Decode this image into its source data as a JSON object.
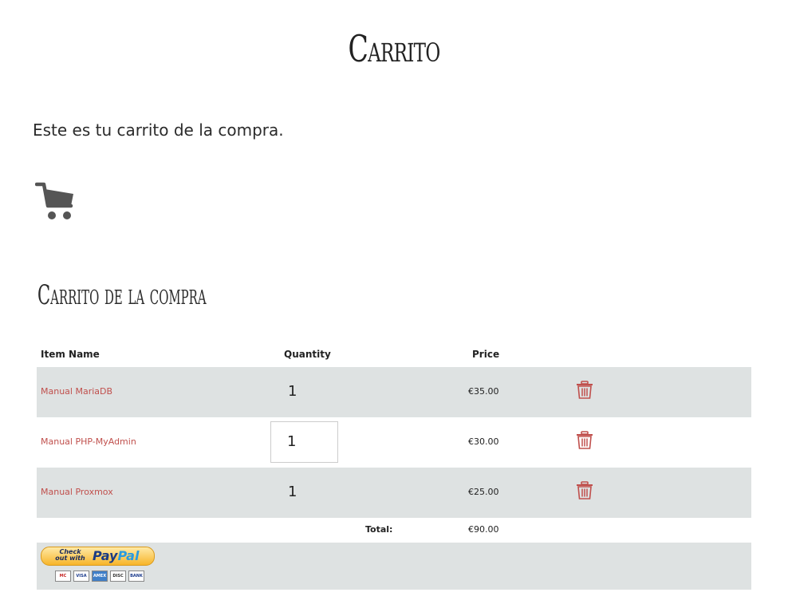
{
  "page": {
    "title": "Carrito",
    "intro": "Este es tu carrito de la compra."
  },
  "cart_section": {
    "title": "Carrito de la compra",
    "columns": {
      "item_name": "Item Name",
      "quantity": "Quantity",
      "price": "Price"
    },
    "items": [
      {
        "name": "Manual MariaDB",
        "quantity": "1",
        "price": "€35.00",
        "editing": false
      },
      {
        "name": "Manual PHP-MyAdmin",
        "quantity": "1",
        "price": "€30.00",
        "editing": true
      },
      {
        "name": "Manual Proxmox",
        "quantity": "1",
        "price": "€25.00",
        "editing": false
      }
    ],
    "total_label": "Total:",
    "total_value": "€90.00"
  },
  "paypal": {
    "checkout_text": "Check out with",
    "logo_part1": "Pay",
    "logo_part2": "Pal",
    "cards": [
      "MC",
      "VISA",
      "AMEX",
      "DISC",
      "BANK"
    ]
  },
  "icons": {
    "cart": "shopping-cart-icon",
    "remove": "trash-icon"
  },
  "colors": {
    "link": "#c0504d",
    "row_shade": "#dee2e2",
    "icon_gray": "#555555",
    "trash_red": "#c0504d"
  }
}
